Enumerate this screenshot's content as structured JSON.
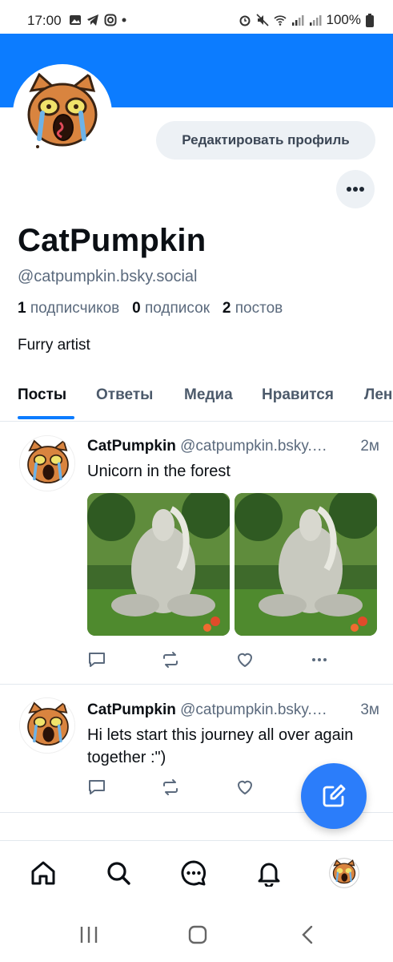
{
  "status_bar": {
    "time": "17:00",
    "battery": "100%"
  },
  "profile": {
    "edit_button": "Редактировать профиль",
    "display_name": "CatPumpkin",
    "handle": "@catpumpkin.bsky.social",
    "followers_count": "1",
    "followers_label": "подписчиков",
    "following_count": "0",
    "following_label": "подписок",
    "posts_count": "2",
    "posts_label": "постов",
    "bio": "Furry artist"
  },
  "tabs": [
    {
      "label": "Посты",
      "active": true
    },
    {
      "label": "Ответы",
      "active": false
    },
    {
      "label": "Медиа",
      "active": false
    },
    {
      "label": "Нравится",
      "active": false
    },
    {
      "label": "Лен",
      "active": false
    }
  ],
  "posts": [
    {
      "author": "CatPumpkin",
      "handle": "@catpumpkin.bsky.…",
      "time": "2м",
      "text": "Unicorn  in the forest",
      "images": [
        "post-image-1",
        "post-image-2"
      ]
    },
    {
      "author": "CatPumpkin",
      "handle": "@catpumpkin.bsky.…",
      "time": "3м",
      "text": "Hi lets start this journey  all over again together  :\")"
    }
  ],
  "bottom_nav": [
    "home-icon",
    "search-icon",
    "chat-icon",
    "bell-icon",
    "profile-avatar"
  ],
  "colors": {
    "accent": "#0c7cff",
    "fab": "#2b7dfa",
    "muted": "#5b6a7d"
  }
}
